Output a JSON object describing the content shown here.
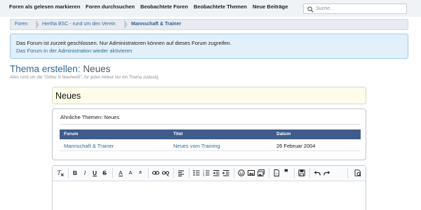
{
  "topnav": {
    "items": [
      "Foren als gelesen markieren",
      "Foren durchsuchen",
      "Beobachtete Foren",
      "Beobachtete Themen",
      "Neue Beiträge"
    ],
    "search_placeholder": "Suche..."
  },
  "breadcrumb": [
    "Foren",
    "Hertha BSC - rund um den Verein",
    "Mannschaft & Trainer"
  ],
  "notice": {
    "text": "Das Forum ist zurzeit geschlossen. Nur Administratoren können auf dieses Forum zugreifen.",
    "link": "Das Forum in der Administration wieder aktivieren"
  },
  "page": {
    "title": "Thema erstellen:",
    "forum_name": "Neues",
    "description": "Alles rund um die \"Götter in blau/weiß\", für jeden Akteur nur ein Thema zulässig"
  },
  "title_field": {
    "value": "Neues"
  },
  "similar": {
    "heading": "Ähnliche Themen: Neues",
    "columns": [
      "Forum",
      "Titel",
      "Datum"
    ],
    "rows": [
      {
        "forum": "Mannschaft & Trainer",
        "title": "Neues vom Training",
        "date": "26 Februar 2004"
      }
    ]
  },
  "toolbar": {
    "bold": "B",
    "italic": "I",
    "underline": "U",
    "strike": "S",
    "font_color": "A",
    "font_size": "A",
    "superscript": "a",
    "quote": "❞"
  }
}
